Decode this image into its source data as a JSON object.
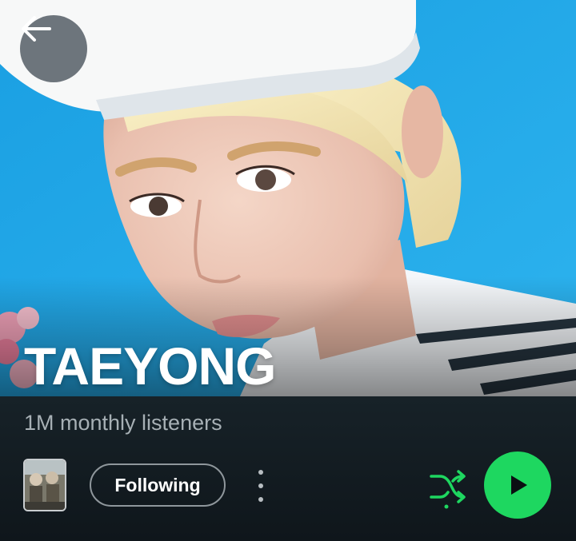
{
  "artist": {
    "name": "TAEYONG",
    "monthly_listeners": "1M monthly listeners"
  },
  "actions": {
    "follow_label": "Following"
  },
  "icons": {
    "back": "arrow-left-icon",
    "more": "more-vertical-icon",
    "shuffle": "shuffle-icon",
    "play": "play-icon"
  },
  "colors": {
    "accent_green": "#1ed760",
    "hero_background": "#1aa3e4",
    "panel_background": "#121a1f",
    "secondary_text": "#a7b0b5"
  }
}
